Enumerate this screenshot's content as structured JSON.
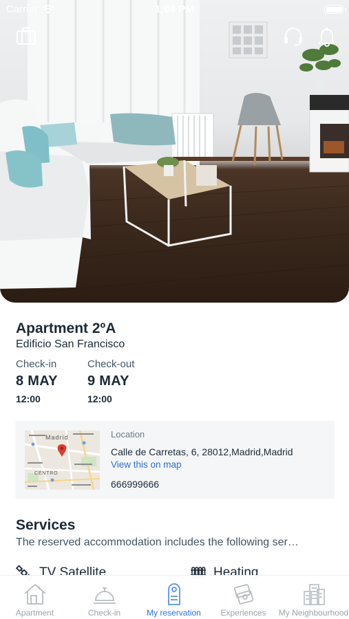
{
  "status_bar": {
    "carrier": "Carrier",
    "time": "1:08 PM"
  },
  "hero": {
    "top_icons": [
      "suitcase-icon",
      "headset-icon",
      "bell-icon"
    ]
  },
  "apartment": {
    "name": "Apartment 2ºA",
    "building": "Edificio San Francisco",
    "check_in": {
      "label": "Check-in",
      "date": "8 MAY",
      "time": "12:00"
    },
    "check_out": {
      "label": "Check-out",
      "date": "9 MAY",
      "time": "12:00"
    }
  },
  "location": {
    "label": "Location",
    "address": "Calle de Carretas, 6, 28012,Madrid,Madrid",
    "link": "View this on map",
    "phone": "666999666",
    "map_labels": [
      "Madrid",
      "CENTRO"
    ]
  },
  "services": {
    "title": "Services",
    "description": "The reserved accommodation includes the following ser…",
    "items": [
      {
        "label": "TV Satellite",
        "icon": "satellite-icon"
      },
      {
        "label": "Heating",
        "icon": "radiator-icon"
      }
    ]
  },
  "tab_bar": {
    "tabs": [
      {
        "label": "Apartment",
        "icon": "house-icon",
        "active": false
      },
      {
        "label": "Check-in",
        "icon": "service-bell-icon",
        "active": false
      },
      {
        "label": "My reservation",
        "icon": "door-hanger-icon",
        "active": true
      },
      {
        "label": "Experiences",
        "icon": "tickets-icon",
        "active": false
      },
      {
        "label": "My Neighbourhood",
        "icon": "buildings-icon",
        "active": false
      }
    ]
  },
  "colors": {
    "accent": "#2d6fd6",
    "text": "#1c2a36",
    "muted": "#9aa3aa",
    "card": "#f5f6f7"
  }
}
